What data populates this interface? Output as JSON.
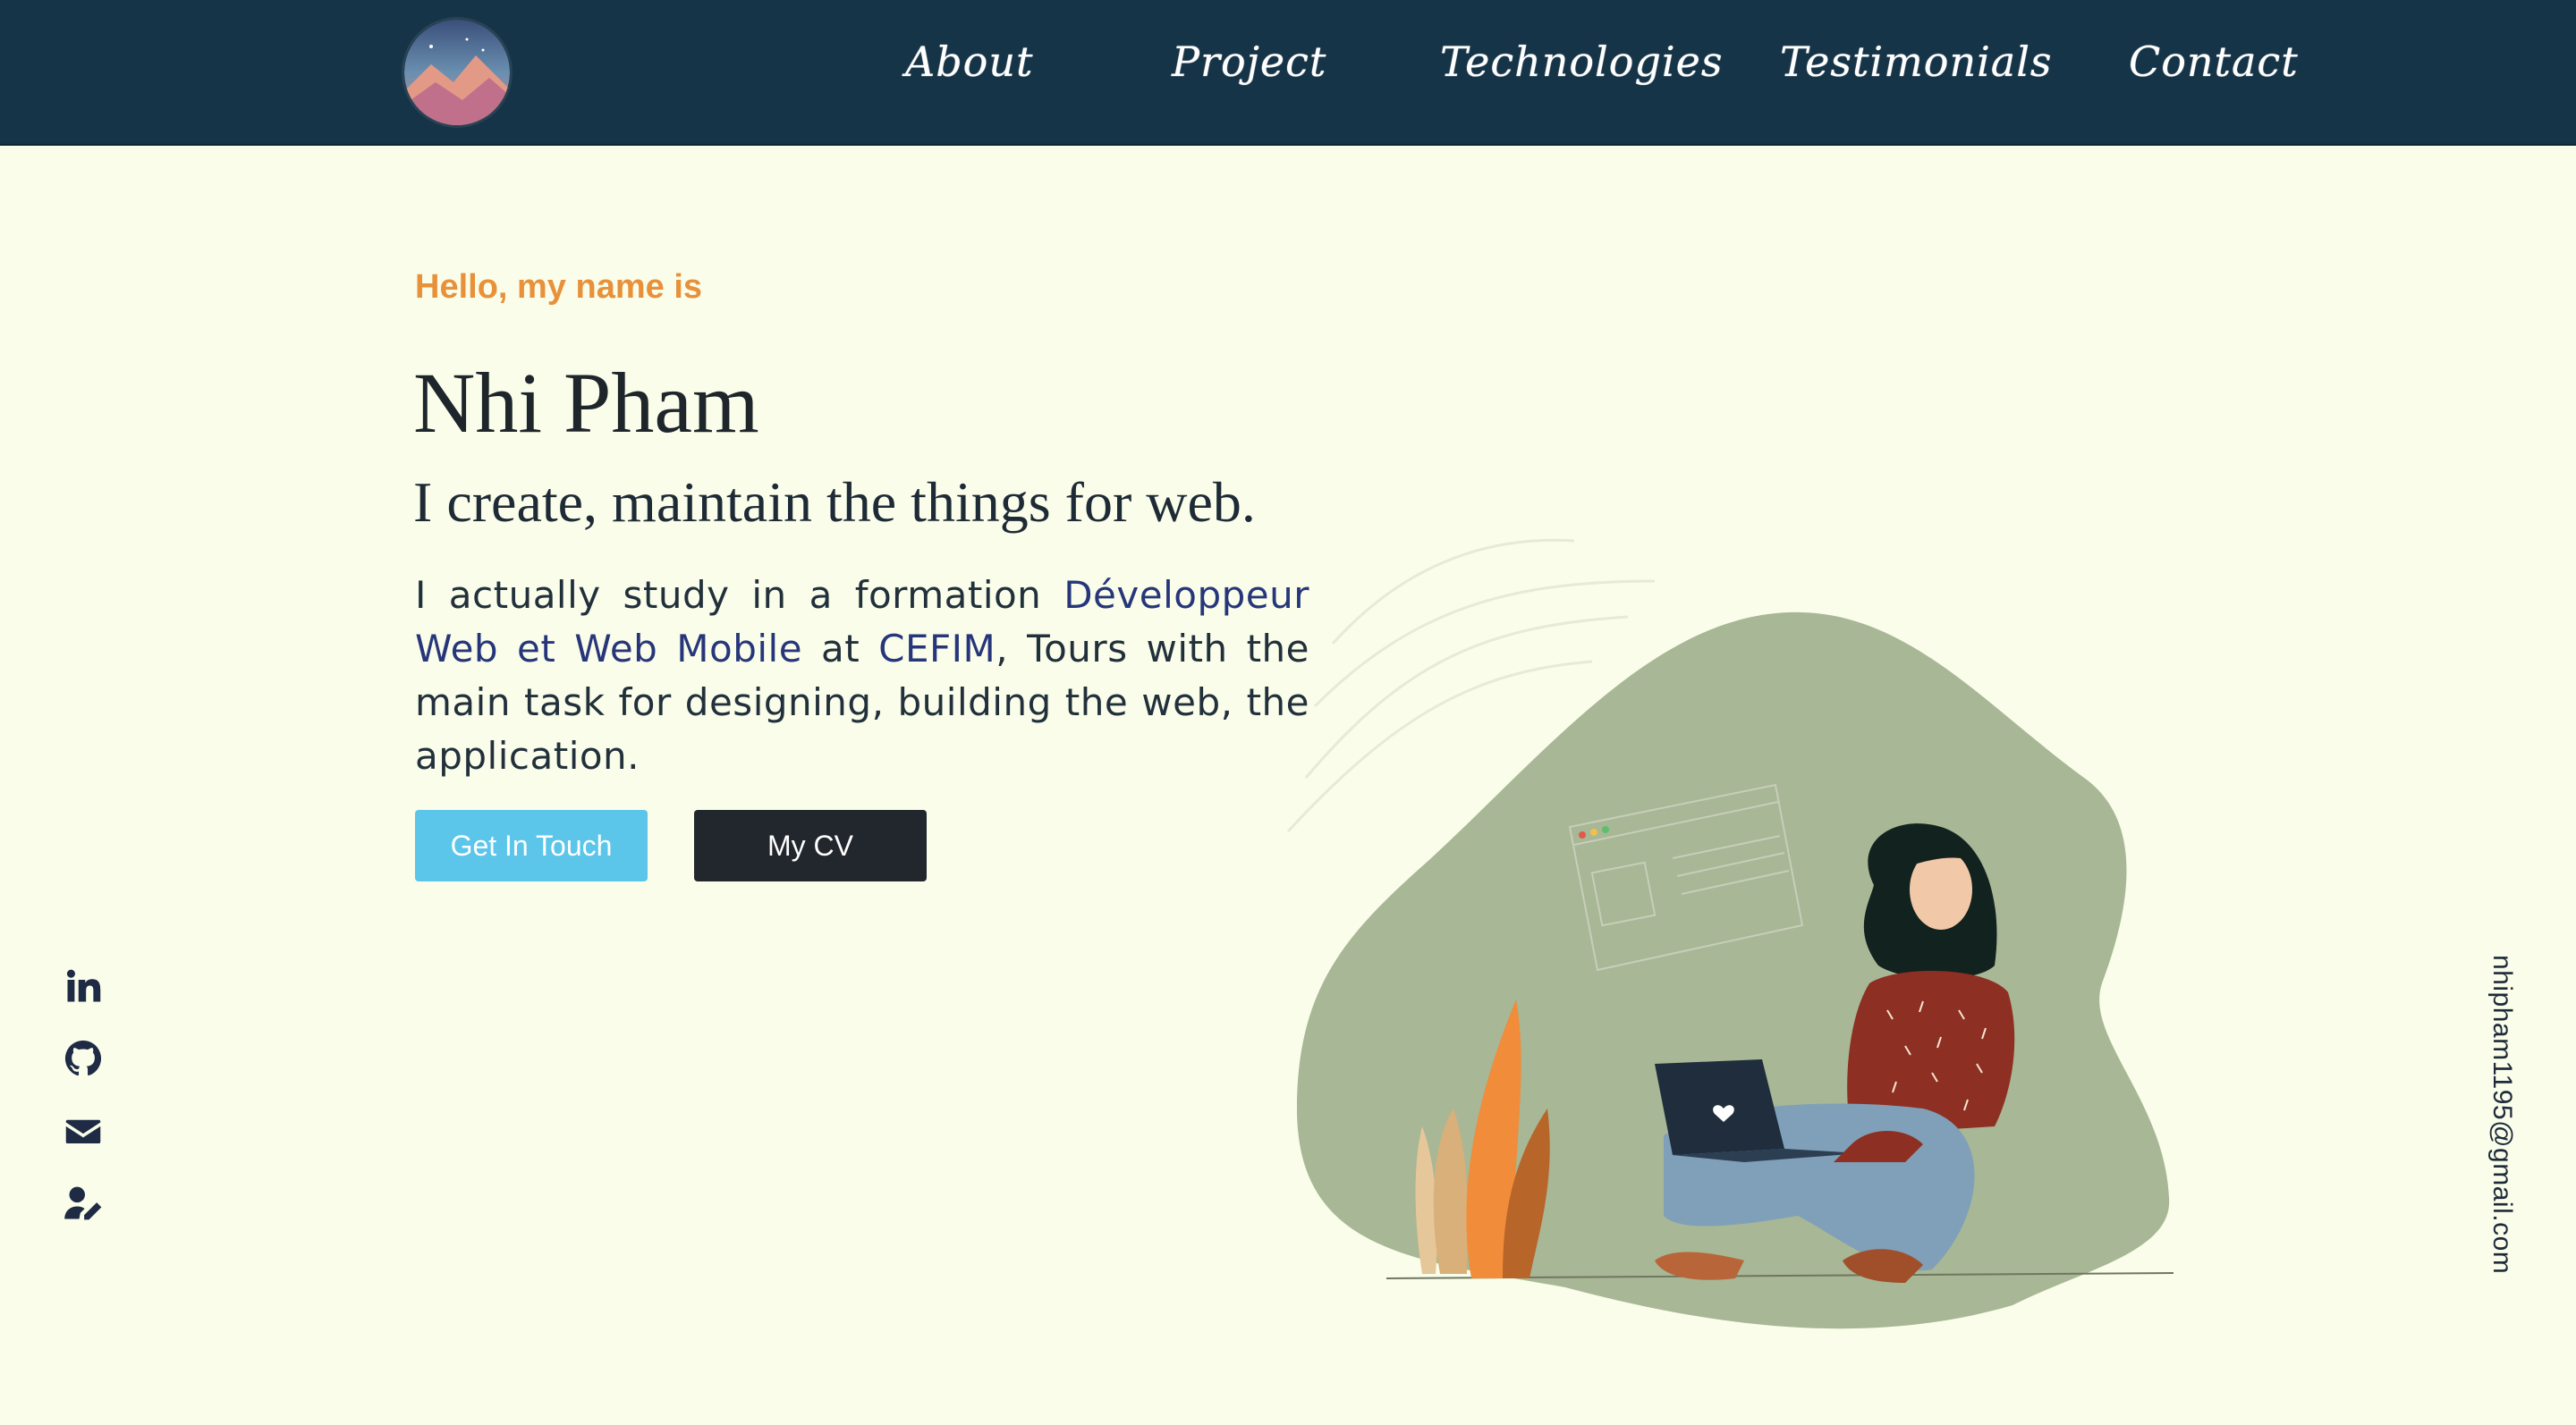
{
  "nav": {
    "items": [
      {
        "label": "About"
      },
      {
        "label": "Project"
      },
      {
        "label": "Technologies"
      },
      {
        "label": "Testimonials"
      },
      {
        "label": "Contact"
      }
    ]
  },
  "hero": {
    "greeting": "Hello, my name is",
    "name": "Nhi Pham",
    "tagline": "I create, maintain the things for web.",
    "desc_part1": "I actually study in a formation ",
    "desc_highlight1": "Développeur Web et Web Mobile",
    "desc_part2": " at ",
    "desc_highlight2": "CEFIM",
    "desc_part3": ", Tours with the main task for designing, building the web, the application.",
    "button_touch": "Get In Touch",
    "button_cv": "My CV"
  },
  "socials": [
    {
      "icon": "linkedin-icon"
    },
    {
      "icon": "github-icon"
    },
    {
      "icon": "envelope-icon"
    },
    {
      "icon": "user-edit-icon"
    }
  ],
  "email": "nhipham1195@gmail.com",
  "colors": {
    "background": "#f9fde9",
    "navbar": "#163447",
    "accent_orange": "#e8913a",
    "button_blue": "#5bc6ea",
    "button_dark": "#22272d",
    "blob_green": "#a8b795"
  }
}
